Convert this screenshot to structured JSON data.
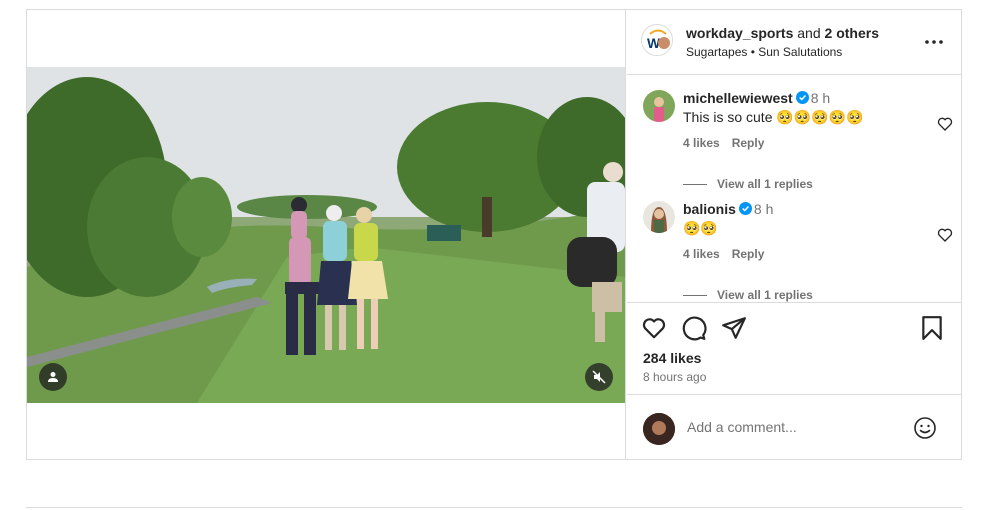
{
  "header": {
    "username": "workday_sports",
    "joiner": " and ",
    "others": "2 others",
    "audio": "Sugartapes • Sun Salutations"
  },
  "comments": [
    {
      "username": "michellewiewest",
      "time": "8 h",
      "text": "This is so cute 🥺🥺🥺🥺🥺",
      "likes": "4 likes",
      "reply": "Reply",
      "view_replies": "View all 1 replies"
    },
    {
      "username": "balionis",
      "time": "8 h",
      "text": "🥺🥺",
      "likes": "4 likes",
      "reply": "Reply",
      "view_replies": "View all 1 replies"
    }
  ],
  "post": {
    "likes": "284 likes",
    "time_ago": "8 hours ago"
  },
  "comment_box": {
    "placeholder": "Add a comment..."
  },
  "colors": {
    "verified": "#0095f6",
    "secondary_text": "#737373",
    "border": "#dbdbdb",
    "primary_text": "#262626"
  },
  "icons": [
    "user-tag-icon",
    "mute-icon",
    "more-icon",
    "verified-icon",
    "heart-icon",
    "comment-icon",
    "share-icon",
    "bookmark-icon",
    "emoji-icon"
  ]
}
